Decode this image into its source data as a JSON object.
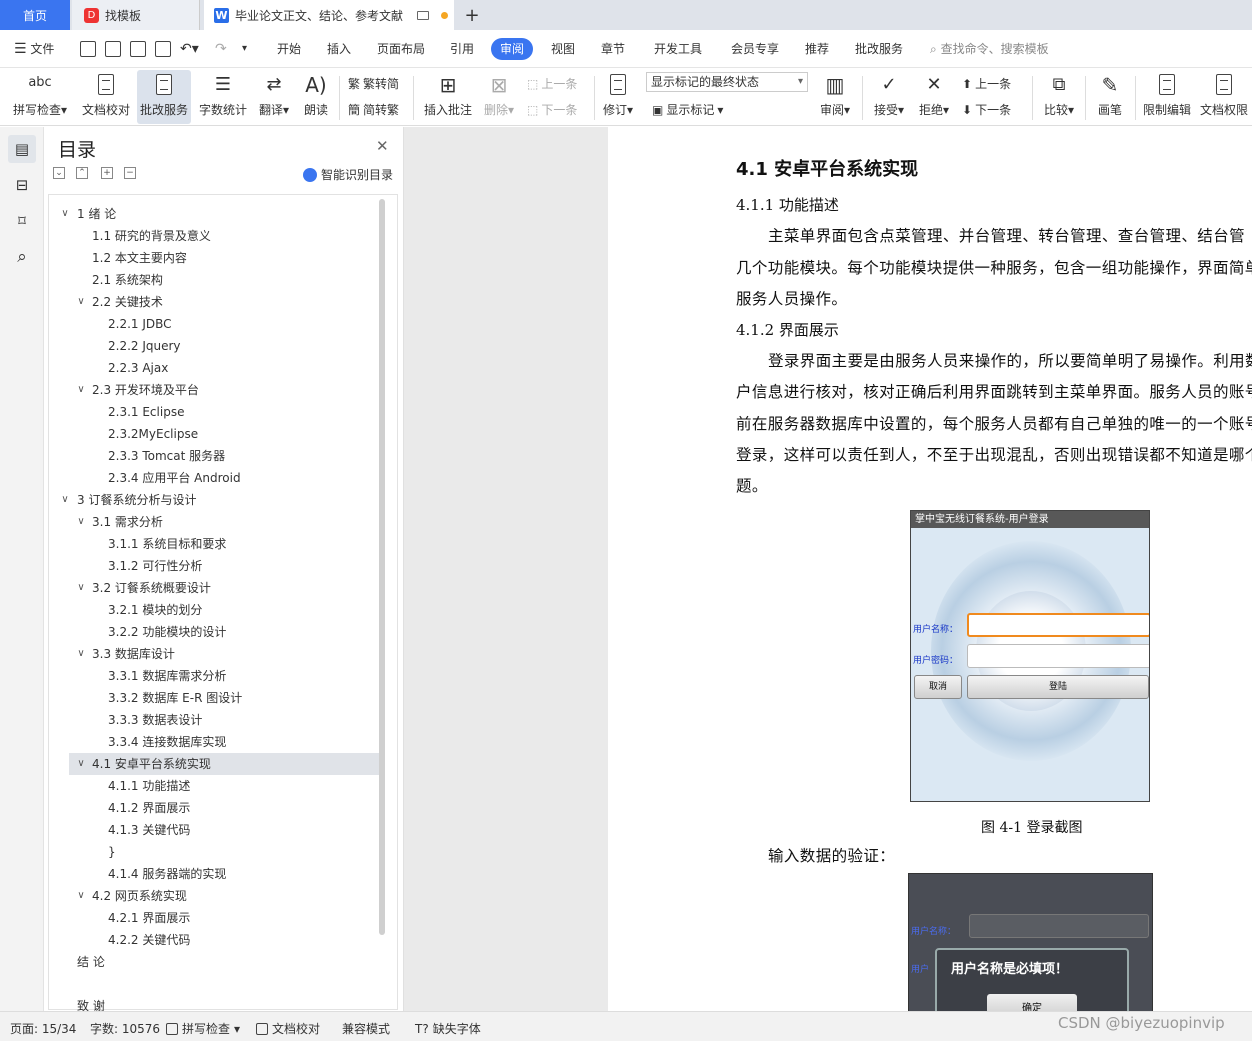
{
  "tabs": {
    "home": "首页",
    "template": "找模板",
    "document": "毕业论文正文、结论、参考文献",
    "new_tab": "+"
  },
  "menu": {
    "file": "文件",
    "items": [
      "开始",
      "插入",
      "页面布局",
      "引用",
      "审阅",
      "视图",
      "章节",
      "开发工具",
      "会员专享",
      "推荐",
      "批改服务"
    ],
    "search_placeholder": "查找命令、搜索模板"
  },
  "ribbon": {
    "spellcheck": "拼写检查",
    "doc_proof": "文档校对",
    "correction": "批改服务",
    "word_count": "字数统计",
    "translate": "翻译",
    "read_aloud": "朗读",
    "trad_to_simp": "繁转简",
    "simp_to_trad": "简转繁",
    "insert_comment": "插入批注",
    "delete": "删除",
    "prev1": "上一条",
    "next1": "下一条",
    "revise": "修订",
    "mark_state": "显示标记的最终状态",
    "show_marks": "显示标记",
    "review": "审阅",
    "accept": "接受",
    "reject": "拒绝",
    "prev2": "上一条",
    "next2": "下一条",
    "compare": "比较",
    "pen": "画笔",
    "restrict_edit": "限制编辑",
    "doc_rights": "文档权限"
  },
  "toc": {
    "title": "目录",
    "smart": "智能识别目录",
    "items": [
      {
        "text": "1  绪  论",
        "level": 1,
        "toggle": "∨"
      },
      {
        "text": "1.1  研究的背景及意义",
        "level": 2,
        "toggle": ""
      },
      {
        "text": "1.2  本文主要内容",
        "level": 2,
        "toggle": ""
      },
      {
        "text": "2.1  系统架构",
        "level": 2,
        "toggle": ""
      },
      {
        "text": "2.2  关键技术",
        "level": 2,
        "toggle": "∨"
      },
      {
        "text": "2.2.1  JDBC",
        "level": 3,
        "toggle": ""
      },
      {
        "text": "2.2.2  Jquery",
        "level": 3,
        "toggle": ""
      },
      {
        "text": "2.2.3  Ajax",
        "level": 3,
        "toggle": ""
      },
      {
        "text": "2.3  开发环境及平台",
        "level": 2,
        "toggle": "∨"
      },
      {
        "text": "2.3.1  Eclipse",
        "level": 3,
        "toggle": ""
      },
      {
        "text": "2.3.2MyEclipse",
        "level": 3,
        "toggle": ""
      },
      {
        "text": "2.3.3  Tomcat 服务器",
        "level": 3,
        "toggle": ""
      },
      {
        "text": "2.3.4  应用平台 Android",
        "level": 3,
        "toggle": ""
      },
      {
        "text": "3  订餐系统分析与设计",
        "level": 1,
        "toggle": "∨"
      },
      {
        "text": "3.1 需求分析",
        "level": 2,
        "toggle": "∨"
      },
      {
        "text": "3.1.1  系统目标和要求",
        "level": 3,
        "toggle": ""
      },
      {
        "text": "3.1.2  可行性分析",
        "level": 3,
        "toggle": ""
      },
      {
        "text": "3.2  订餐系统概要设计",
        "level": 2,
        "toggle": "∨"
      },
      {
        "text": "3.2.1  模块的划分",
        "level": 3,
        "toggle": ""
      },
      {
        "text": "3.2.2  功能模块的设计",
        "level": 3,
        "toggle": ""
      },
      {
        "text": "3.3  数据库设计",
        "level": 2,
        "toggle": "∨"
      },
      {
        "text": "3.3.1  数据库需求分析",
        "level": 3,
        "toggle": ""
      },
      {
        "text": "3.3.2  数据库 E-R 图设计",
        "level": 3,
        "toggle": ""
      },
      {
        "text": "3.3.3  数据表设计",
        "level": 3,
        "toggle": ""
      },
      {
        "text": "3.3.4  连接数据库实现",
        "level": 3,
        "toggle": ""
      },
      {
        "text": "4.1  安卓平台系统实现",
        "level": 2,
        "toggle": "∨",
        "selected": true
      },
      {
        "text": "4.1.1  功能描述",
        "level": 3,
        "toggle": ""
      },
      {
        "text": "4.1.2  界面展示",
        "level": 3,
        "toggle": ""
      },
      {
        "text": "4.1.3  关键代码",
        "level": 3,
        "toggle": ""
      },
      {
        "text": "}",
        "level": 3,
        "toggle": ""
      },
      {
        "text": "4.1.4  服务器端的实现",
        "level": 3,
        "toggle": ""
      },
      {
        "text": "4.2  网页系统实现",
        "level": 2,
        "toggle": "∨"
      },
      {
        "text": "4.2.1  界面展示",
        "level": 3,
        "toggle": ""
      },
      {
        "text": "4.2.2  关键代码",
        "level": 3,
        "toggle": ""
      },
      {
        "text": "结    论",
        "level": 1,
        "toggle": ""
      },
      {
        "text": "",
        "level": 1,
        "toggle": ""
      },
      {
        "text": "致    谢",
        "level": 1,
        "toggle": ""
      }
    ]
  },
  "page": {
    "section_title": "4.1 安卓平台系统实现",
    "sub1": "4.1.1   功能描述",
    "para1": [
      "主菜单界面包含点菜管理、并台管理、转台管理、查台管理、结台管",
      "几个功能模块。每个功能模块提供一种服务，包含一组功能操作，界面简单",
      "服务人员操作。"
    ],
    "sub2": "4.1.2   界面展示",
    "para2": [
      "登录界面主要是由服务人员来操作的，所以要简单明了易操作。利用数",
      "户信息进行核对，核对正确后利用界面跳转到主菜单界面。服务人员的账号",
      "前在服务器数据库中设置的，每个服务人员都有自己单独的唯一的一个账号",
      "登录，这样可以责任到人，不至于出现混乱，否则出现错误都不知道是哪个",
      "题。"
    ],
    "figure1": {
      "title": "掌中宝无线订餐系统-用户登录",
      "user_label": "用户名称：",
      "pwd_label": "用户密码：",
      "cancel": "取消",
      "login": "登陆",
      "caption": "图 4-1  登录截图"
    },
    "para3": "输入数据的验证：",
    "figure2": {
      "user_label": "用户名称：",
      "user_label_cut": "用户",
      "dialog": "用户名称是必填项！",
      "ok": "确定"
    }
  },
  "status": {
    "page": "页面: 15/34",
    "words": "字数: 10576",
    "spellcheck": "拼写检查",
    "proof": "文档校对",
    "compat": "兼容模式",
    "missing_font": "缺失字体"
  },
  "watermark": "CSDN @biyezuopinvip",
  "colors": {
    "accent": "#3a75f0",
    "warning_dot": "#f5a623"
  }
}
